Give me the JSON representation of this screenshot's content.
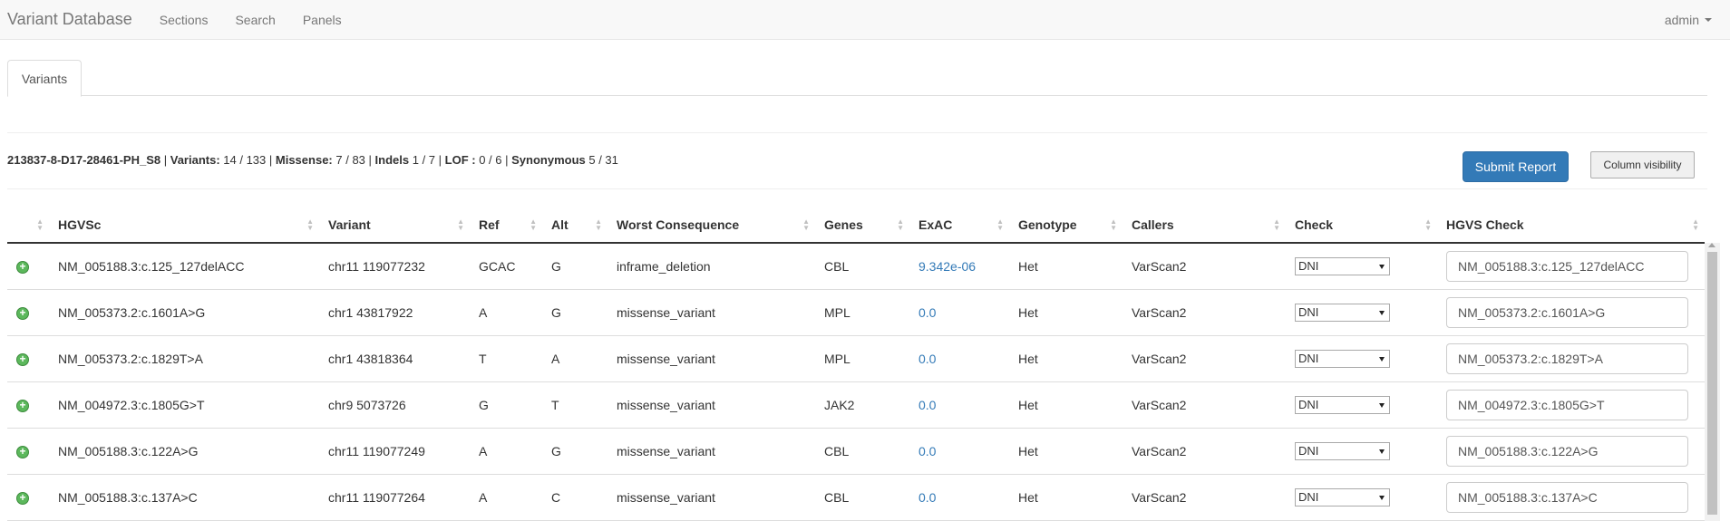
{
  "navbar": {
    "brand": "Variant Database",
    "links": [
      "Sections",
      "Search",
      "Panels"
    ],
    "user": "admin"
  },
  "tabs": [
    "Variants"
  ],
  "summary": {
    "sample": "213837-8-D17-28461-PH_S8",
    "variants_label": "Variants:",
    "variants_value": "14 / 133",
    "missense_label": "Missense:",
    "missense_value": "7 / 83",
    "indels_label": "Indels",
    "indels_value": "1 / 7",
    "lof_label": "LOF :",
    "lof_value": "0 / 6",
    "synonymous_label": "Synonymous",
    "synonymous_value": "5 / 31"
  },
  "buttons": {
    "submit": "Submit Report",
    "column_visibility": "Column visibility"
  },
  "table": {
    "columns": [
      "",
      "HGVSc",
      "Variant",
      "Ref",
      "Alt",
      "Worst Consequence",
      "Genes",
      "ExAC",
      "Genotype",
      "Callers",
      "Check",
      "HGVS Check"
    ],
    "rows": [
      {
        "hgvsc": "NM_005188.3:c.125_127delACC",
        "variant": "chr11 119077232",
        "ref": "GCAC",
        "alt": "G",
        "consequence": "inframe_deletion",
        "genes": "CBL",
        "exac": "9.342e-06",
        "genotype": "Het",
        "callers": "VarScan2",
        "check": "DNI",
        "hgvs_check": "NM_005188.3:c.125_127delACC"
      },
      {
        "hgvsc": "NM_005373.2:c.1601A>G",
        "variant": "chr1 43817922",
        "ref": "A",
        "alt": "G",
        "consequence": "missense_variant",
        "genes": "MPL",
        "exac": "0.0",
        "genotype": "Het",
        "callers": "VarScan2",
        "check": "DNI",
        "hgvs_check": "NM_005373.2:c.1601A>G"
      },
      {
        "hgvsc": "NM_005373.2:c.1829T>A",
        "variant": "chr1 43818364",
        "ref": "T",
        "alt": "A",
        "consequence": "missense_variant",
        "genes": "MPL",
        "exac": "0.0",
        "genotype": "Het",
        "callers": "VarScan2",
        "check": "DNI",
        "hgvs_check": "NM_005373.2:c.1829T>A"
      },
      {
        "hgvsc": "NM_004972.3:c.1805G>T",
        "variant": "chr9 5073726",
        "ref": "G",
        "alt": "T",
        "consequence": "missense_variant",
        "genes": "JAK2",
        "exac": "0.0",
        "genotype": "Het",
        "callers": "VarScan2",
        "check": "DNI",
        "hgvs_check": "NM_004972.3:c.1805G>T"
      },
      {
        "hgvsc": "NM_005188.3:c.122A>G",
        "variant": "chr11 119077249",
        "ref": "A",
        "alt": "G",
        "consequence": "missense_variant",
        "genes": "CBL",
        "exac": "0.0",
        "genotype": "Het",
        "callers": "VarScan2",
        "check": "DNI",
        "hgvs_check": "NM_005188.3:c.122A>G"
      },
      {
        "hgvsc": "NM_005188.3:c.137A>C",
        "variant": "chr11 119077264",
        "ref": "A",
        "alt": "C",
        "consequence": "missense_variant",
        "genes": "CBL",
        "exac": "0.0",
        "genotype": "Het",
        "callers": "VarScan2",
        "check": "DNI",
        "hgvs_check": "NM_005188.3:c.137A>C"
      }
    ]
  },
  "icons": {
    "expand": "plus-circle-icon",
    "sort": "sort-both-icon",
    "dropdown": "caret-down-icon"
  },
  "colors": {
    "primary": "#337ab7",
    "success": "#5cb85c",
    "navbar_bg": "#f8f8f8"
  }
}
